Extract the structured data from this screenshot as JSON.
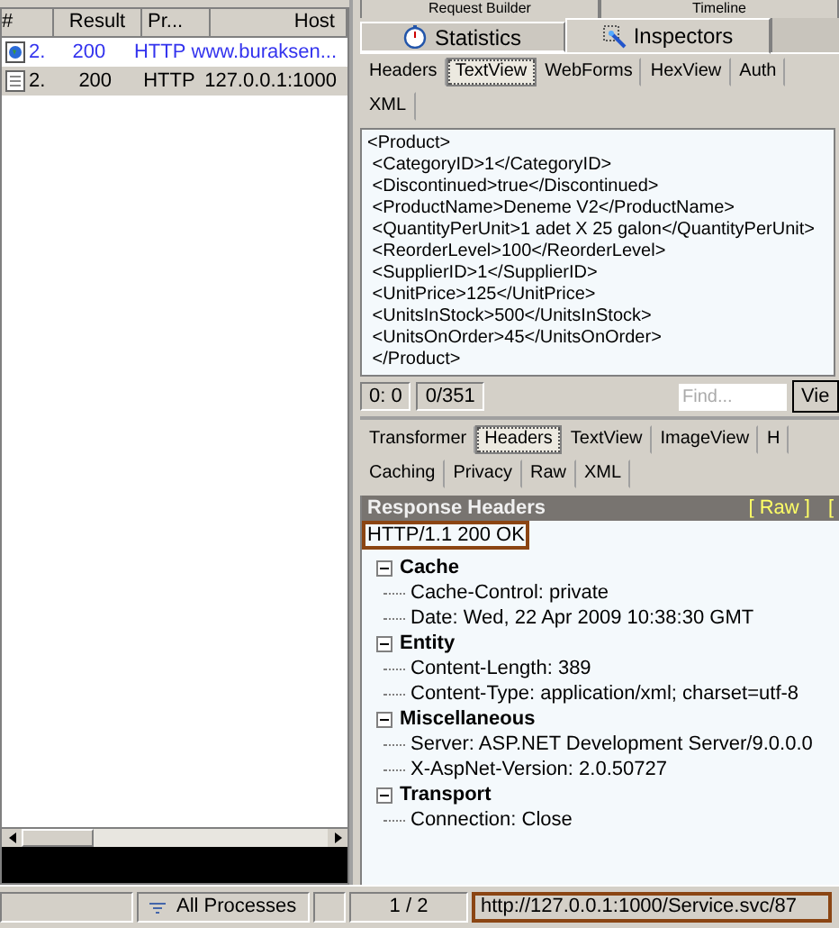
{
  "sessions": {
    "columns": [
      "#",
      "Result",
      "Pr...",
      "Host"
    ],
    "rows": [
      {
        "kind": "web",
        "selected": false,
        "color": "#3333ee",
        "cells": [
          "2.",
          "200",
          "HTTP",
          "www.buraksen..."
        ]
      },
      {
        "kind": "document",
        "selected": true,
        "color": "#000000",
        "cells": [
          "2.",
          "200",
          "HTTP",
          "127.0.0.1:1000"
        ]
      }
    ]
  },
  "top_tabs": [
    {
      "label": "Request Builder",
      "selected": false
    },
    {
      "label": "Timeline",
      "selected": false
    }
  ],
  "main_tabs": [
    {
      "label": "Statistics",
      "kind": "stopwatch",
      "selected": false
    },
    {
      "label": "Inspectors",
      "kind": "inspector",
      "selected": true
    }
  ],
  "request_tabs": [
    [
      {
        "label": "Headers",
        "selected": false
      },
      {
        "label": "TextView",
        "selected": true
      },
      {
        "label": "WebForms",
        "selected": false
      },
      {
        "label": "HexView",
        "selected": false
      },
      {
        "label": "Auth",
        "selected": false
      }
    ],
    [
      {
        "label": "XML",
        "selected": false
      }
    ]
  ],
  "request_body": [
    "<Product>",
    " <CategoryID>1</CategoryID>",
    " <Discontinued>true</Discontinued>",
    " <ProductName>Deneme V2</ProductName>",
    " <QuantityPerUnit>1 adet X 25 galon</QuantityPerUnit>",
    " <ReorderLevel>100</ReorderLevel>",
    " <SupplierID>1</SupplierID>",
    " <UnitPrice>125</UnitPrice>",
    " <UnitsInStock>500</UnitsInStock>",
    " <UnitsOnOrder>45</UnitsOnOrder>",
    " </Product>"
  ],
  "request_status": {
    "position": "0: 0",
    "count": "0/351",
    "find_placeholder": "Find...",
    "view_button": "Vie"
  },
  "response_tabs": [
    [
      {
        "label": "Transformer",
        "selected": false
      },
      {
        "label": "Headers",
        "selected": true
      },
      {
        "label": "TextView",
        "selected": false
      },
      {
        "label": "ImageView",
        "selected": false
      },
      {
        "label": "H",
        "selected": false
      }
    ],
    [
      {
        "label": "Caching",
        "selected": false
      },
      {
        "label": "Privacy",
        "selected": false
      },
      {
        "label": "Raw",
        "selected": false
      },
      {
        "label": "XML",
        "selected": false
      }
    ]
  ],
  "response_headers": {
    "title": "Response Headers",
    "links": [
      "[ Raw ]",
      "["
    ],
    "status_line": "HTTP/1.1 200 OK",
    "groups": [
      {
        "name": "Cache",
        "expanded": true,
        "children": [
          "Cache-Control: private",
          "Date: Wed, 22 Apr 2009 10:38:30 GMT"
        ]
      },
      {
        "name": "Entity",
        "expanded": true,
        "children": [
          "Content-Length: 389",
          "Content-Type: application/xml; charset=utf-8"
        ]
      },
      {
        "name": "Miscellaneous",
        "expanded": true,
        "children": [
          "Server: ASP.NET Development Server/9.0.0.0",
          "X-AspNet-Version: 2.0.50727"
        ]
      },
      {
        "name": "Transport",
        "expanded": true,
        "children": [
          "Connection: Close"
        ]
      }
    ]
  },
  "status_bar": {
    "process_filter": "All Processes",
    "session_count": "1 / 2",
    "url": "http://127.0.0.1:1000/Service.svc/87"
  }
}
